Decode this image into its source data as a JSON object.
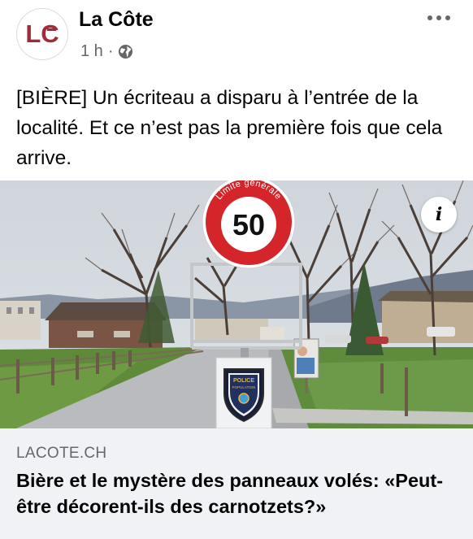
{
  "post": {
    "page_name": "La Côte",
    "avatar_text": "LC",
    "timestamp": "1 h",
    "separator": "·",
    "audience_icon": "globe-icon",
    "more_icon": "more-options-icon",
    "text": "[BIÈRE] Un écriteau a disparu à l’entrée de la localité. Et ce n’est pas la première fois que cela arrive."
  },
  "link_preview": {
    "sign_label": "Limite générale",
    "speed_limit": "50",
    "police_badge_top": "POLICE",
    "police_badge_sub": "POPULATION",
    "info_glyph": "i",
    "domain": "LACOTE.CH",
    "title": "Bière et le mystère des panneaux volés: «Peut-être décorent-ils des carnotzets?»"
  },
  "colors": {
    "brand": "#a32a3a",
    "secondary_text": "#65676b",
    "footer_bg": "#f0f2f5",
    "sign_red": "#d3252a"
  }
}
